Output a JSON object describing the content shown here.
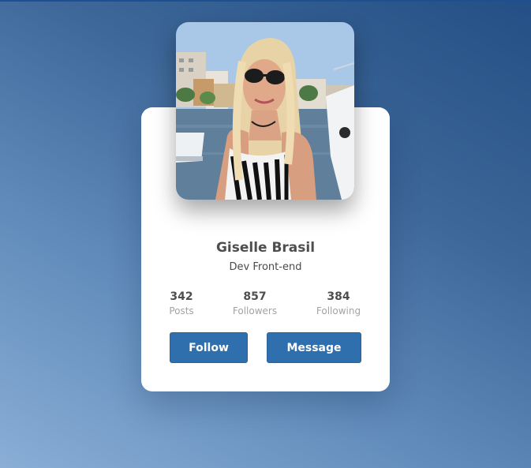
{
  "profile": {
    "name": "Giselle Brasil",
    "role": "Dev Front-end",
    "photo_icon": "profile-photo"
  },
  "stats": [
    {
      "value": "342",
      "label": "Posts"
    },
    {
      "value": "857",
      "label": "Followers"
    },
    {
      "value": "384",
      "label": "Following"
    }
  ],
  "actions": {
    "follow_label": "Follow",
    "message_label": "Message"
  },
  "colors": {
    "button": "#2f6fad",
    "card": "#ffffff",
    "background_light": "#8aaed6",
    "background_dark": "#234f86"
  }
}
